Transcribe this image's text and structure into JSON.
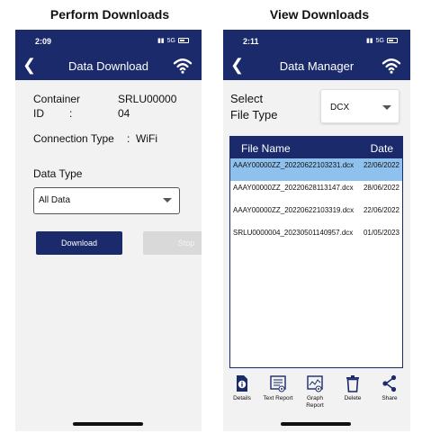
{
  "captions": {
    "left": "Perform Downloads",
    "right": "View Downloads"
  },
  "left_phone": {
    "status_time": "2:09",
    "status_network": "5G",
    "title": "Data Download",
    "container_id_label_1": "Container",
    "container_id_label_2": "ID",
    "container_id_colon": ":",
    "container_id_value_1": "SRLU00000",
    "container_id_value_2": "04",
    "connection_type_label": "Connection Type",
    "connection_type_colon": ":",
    "connection_type_value": "WiFi",
    "data_type_label": "Data Type",
    "data_type_value": "All Data",
    "download_button": "Download",
    "stop_button": "Stop",
    "accent_color": "#1b2a6b"
  },
  "right_phone": {
    "status_time": "2:11",
    "status_network": "5G",
    "title": "Data Manager",
    "file_type_label_1": "Select",
    "file_type_label_2": "File Type",
    "file_type_value": "DCX",
    "table": {
      "headers": [
        "File Name",
        "Date"
      ],
      "rows": [
        {
          "name": "AAAY00000ZZ_20220622103231.dcx",
          "date": "22/06/2022",
          "selected": true
        },
        {
          "name": "AAAY00000ZZ_20220628113147.dcx",
          "date": "28/06/2022",
          "selected": false
        },
        {
          "name": "AAAY00000ZZ_20220622103319.dcx",
          "date": "22/06/2022",
          "selected": false
        },
        {
          "name": "SRLU0000004_20230501140957.dcx",
          "date": "01/05/2023",
          "selected": false
        }
      ]
    },
    "toolbar": {
      "details": "Details",
      "text_report": "Text Report",
      "graph_report_1": "Graph",
      "graph_report_2": "Report",
      "delete": "Delete",
      "share": "Share"
    },
    "selected_row_color": "#8fc1ee"
  }
}
